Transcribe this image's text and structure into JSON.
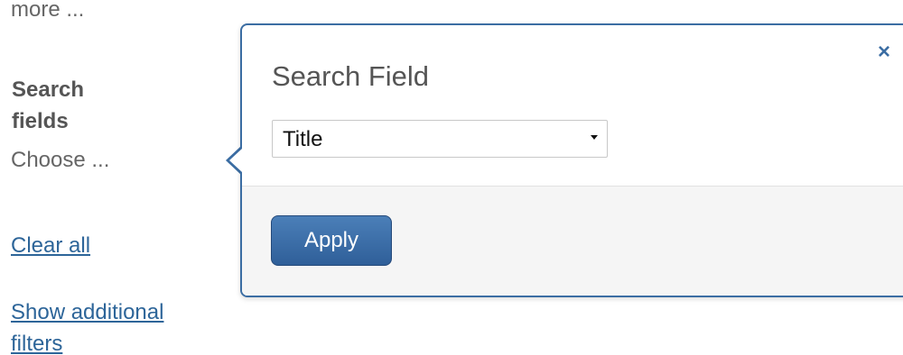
{
  "sidebar": {
    "more_link": "more ...",
    "search_fields_heading": "Search fields",
    "search_fields_choose": "Choose ...",
    "clear_all": "Clear all",
    "show_additional_filters": "Show additional filters"
  },
  "popover": {
    "title": "Search Field",
    "close_glyph": "×",
    "select": {
      "selected_value": "Title"
    },
    "apply_label": "Apply"
  },
  "colors": {
    "link": "#2d6599",
    "accent": "#3b6da3",
    "button": "#2f5f99"
  }
}
